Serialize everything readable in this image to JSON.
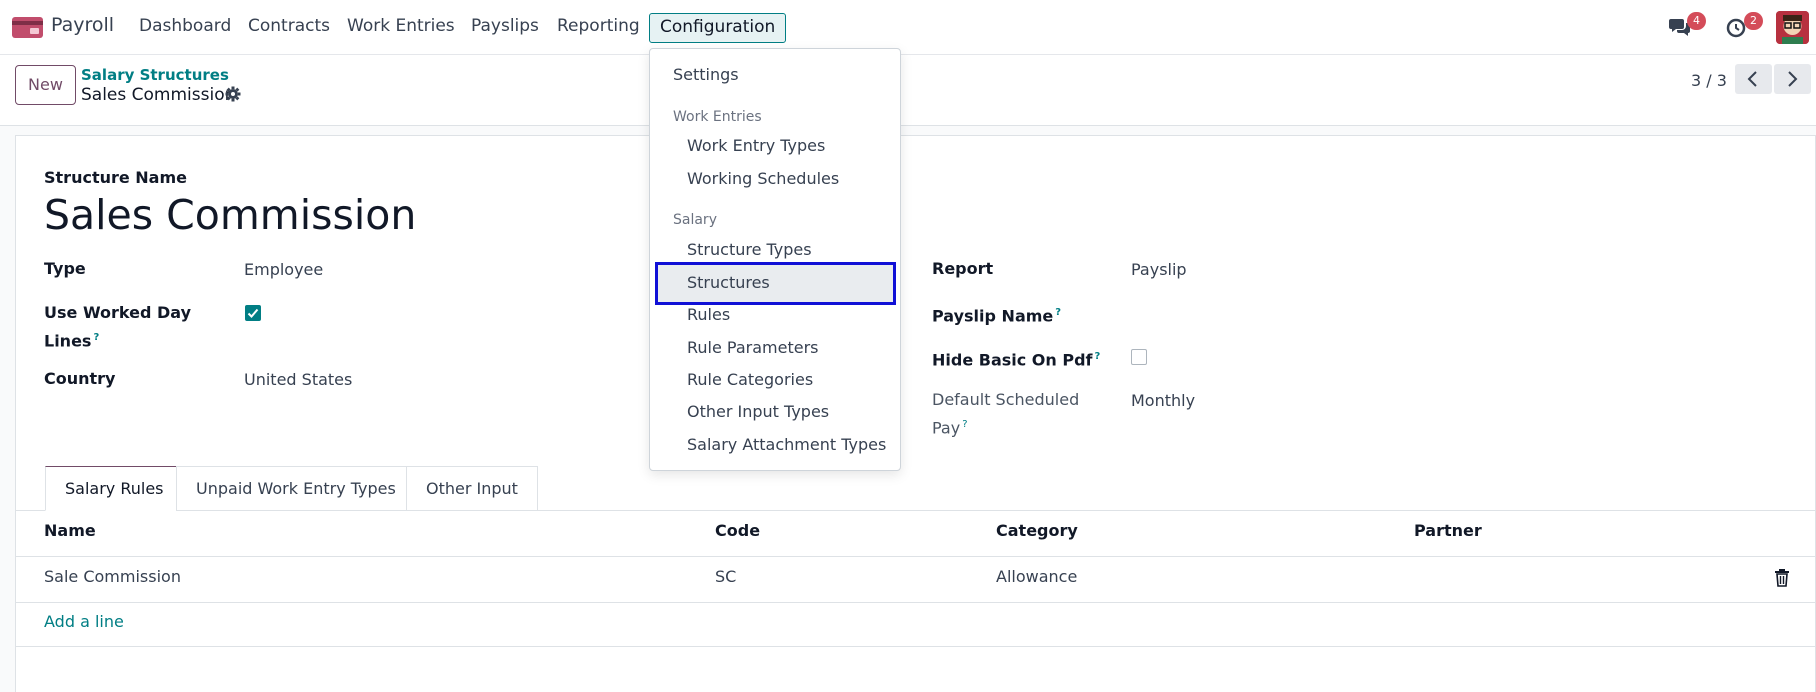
{
  "navbar": {
    "app_name": "Payroll",
    "menu": [
      "Dashboard",
      "Contracts",
      "Work Entries",
      "Payslips",
      "Reporting",
      "Configuration"
    ],
    "chat_badge": "4",
    "activity_badge": "2",
    "accent_color": "#017e84",
    "badge_color": "#d44c59"
  },
  "control": {
    "new_label": "New",
    "breadcrumb_parent": "Salary Structures",
    "breadcrumb_current": "Sales Commission",
    "pager": "3 / 3"
  },
  "form": {
    "structure_name_label": "Structure Name",
    "structure_name": "Sales Commission",
    "type_label": "Type",
    "type_value": "Employee",
    "use_worked_day_lines_label_1": "Use Worked Day",
    "use_worked_day_lines_label_2": "Lines",
    "use_worked_day_lines_checked": true,
    "country_label": "Country",
    "country_value": "United States",
    "report_label": "Report",
    "report_value": "Payslip",
    "payslip_name_label": "Payslip Name",
    "hide_basic_label": "Hide Basic On Pdf",
    "hide_basic_checked": false,
    "default_pay_label_1": "Default Scheduled",
    "default_pay_label_2": "Pay",
    "default_pay_value": "Monthly",
    "help_mark": "?"
  },
  "tabs": [
    "Salary Rules",
    "Unpaid Work Entry Types",
    "Other Input"
  ],
  "table": {
    "columns": [
      "Name",
      "Code",
      "Category",
      "Partner"
    ],
    "rows": [
      {
        "name": "Sale Commission",
        "code": "SC",
        "category": "Allowance",
        "partner": ""
      }
    ],
    "add_line": "Add a line"
  },
  "dropdown": {
    "settings": "Settings",
    "work_entries_header": "Work Entries",
    "work_entry_types": "Work Entry Types",
    "working_schedules": "Working Schedules",
    "salary_header": "Salary",
    "structure_types": "Structure Types",
    "structures": "Structures",
    "rules": "Rules",
    "rule_parameters": "Rule Parameters",
    "rule_categories": "Rule Categories",
    "other_input_types": "Other Input Types",
    "salary_attachment_types": "Salary Attachment Types",
    "highlight_color": "#1010d6"
  }
}
